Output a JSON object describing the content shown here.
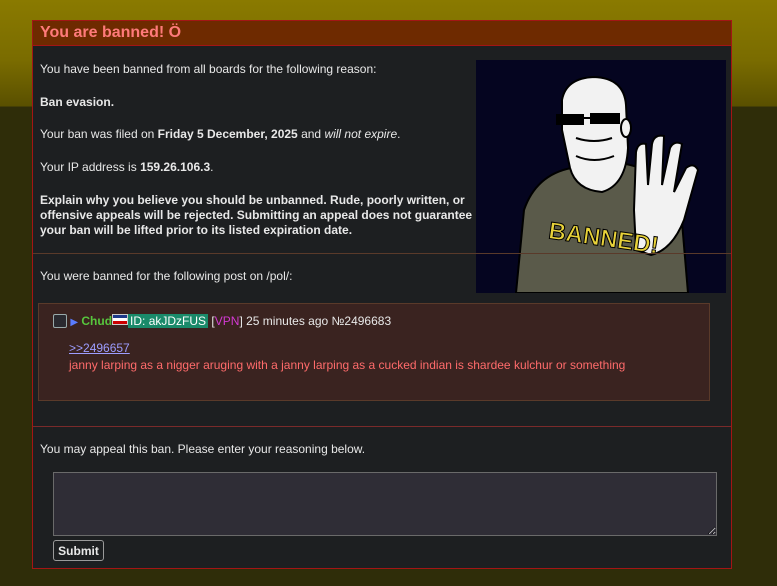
{
  "title": "You are banned! Ö",
  "intro": "You have been banned from all boards for the following reason:",
  "reason": "Ban evasion.",
  "filed_prefix": "Your ban was filed on ",
  "filed_date": "Friday 5 December, 2025",
  "filed_and": " and ",
  "expiry": "will not expire",
  "filed_end": ".",
  "ip_prefix": "Your IP address is ",
  "ip": "159.26.106.3",
  "ip_end": ".",
  "explain": "Explain why you believe you should be unbanned. Rude, poorly written, or offensive appeals will be rejected. Submitting an appeal does not guarantee your ban will be lifted prior to its listed expiration date.",
  "banned_for": "You were banned for the following post on /pol/:",
  "image_text": "BANNED!",
  "post": {
    "name": "Chud",
    "id_label": "ID: akJDzFUS",
    "vpn_open": "[",
    "vpn": "VPN",
    "vpn_close": "]",
    "time": "25 minutes ago",
    "number": "№2496683",
    "quote": ">>2496657",
    "body": "janny larping as a nigger aruging with a janny larping as a cucked indian is shardee kulchur or something"
  },
  "appeal_prompt": "You may appeal this ban. Please enter your reasoning below.",
  "submit_label": "Submit",
  "colors": {
    "title_bg": "#6e2a00",
    "title_text": "#ff7a7a",
    "border": "#a31515",
    "post_bg": "#3a2320",
    "name": "#57c63d",
    "id_bg": "#1a8a6a",
    "vpn": "#d33ad3",
    "quote_link": "#9d9dff",
    "post_text": "#ff6b6b"
  }
}
